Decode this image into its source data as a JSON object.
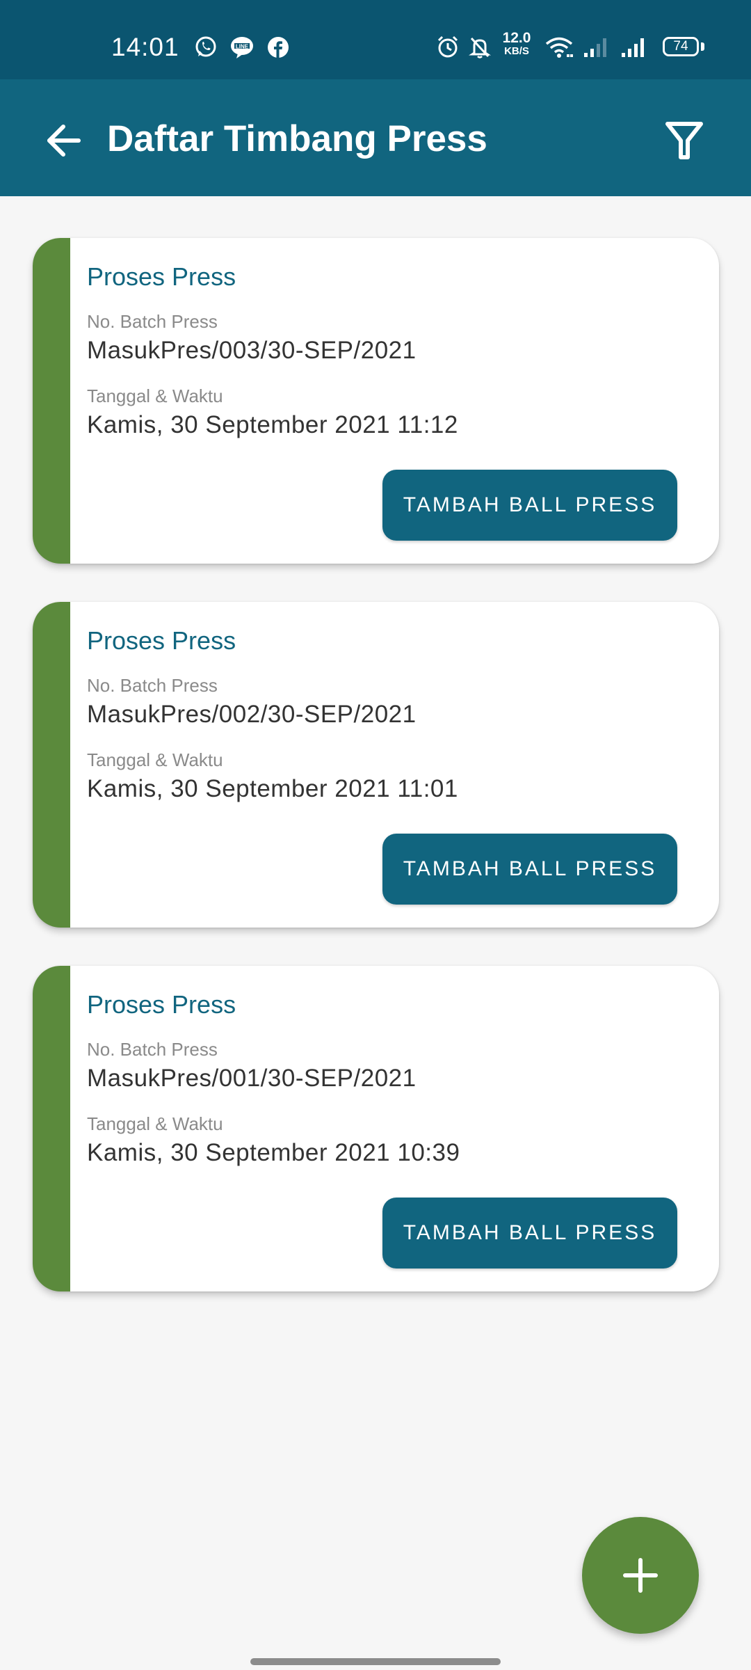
{
  "status_bar": {
    "time": "14:01",
    "notification_icons": [
      "whatsapp-icon",
      "line-icon",
      "facebook-icon"
    ],
    "system_icons": [
      "alarm-icon",
      "silent-bell-icon",
      "wifi-icon",
      "signal-icon",
      "signal-icon"
    ],
    "network_speed": "12.0",
    "network_speed_unit": "KB/S",
    "battery": "74"
  },
  "app_bar": {
    "title": "Daftar Timbang Press",
    "back_icon": "arrow-left-icon",
    "filter_icon": "filter-icon"
  },
  "cards": [
    {
      "title": "Proses Press",
      "batch_label": "No. Batch Press",
      "batch_value": "MasukPres/003/30-SEP/2021",
      "date_label": "Tanggal & Waktu",
      "date_value": "Kamis, 30 September 2021 11:12",
      "button": "TAMBAH BALL PRESS"
    },
    {
      "title": "Proses Press",
      "batch_label": "No. Batch Press",
      "batch_value": "MasukPres/002/30-SEP/2021",
      "date_label": "Tanggal & Waktu",
      "date_value": "Kamis, 30 September 2021 11:01",
      "button": "TAMBAH BALL PRESS"
    },
    {
      "title": "Proses Press",
      "batch_label": "No. Batch Press",
      "batch_value": "MasukPres/001/30-SEP/2021",
      "date_label": "Tanggal & Waktu",
      "date_value": "Kamis, 30 September 2021 10:39",
      "button": "TAMBAH BALL PRESS"
    }
  ],
  "fab": {
    "icon": "plus-icon"
  },
  "colors": {
    "status_bar": "#0b5570",
    "app_bar": "#11657f",
    "accent_green": "#5b8a3c",
    "primary_text": "#11657f",
    "background": "#f6f6f6"
  }
}
